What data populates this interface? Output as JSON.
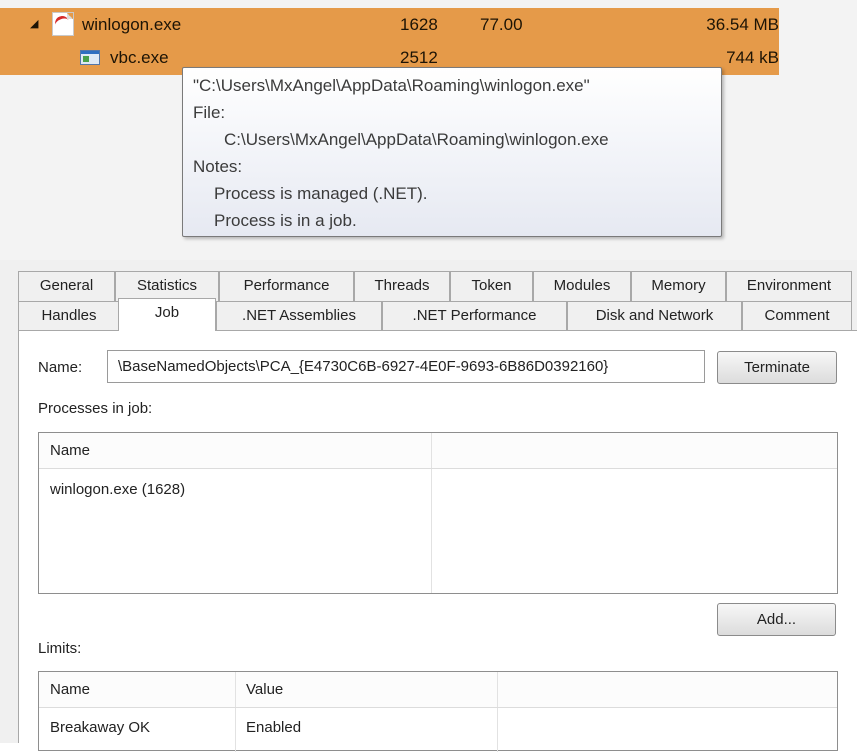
{
  "processes": [
    {
      "name": "winlogon.exe",
      "pid": "1628",
      "cpu": "77.00",
      "memory": "36.54 MB"
    },
    {
      "name": "vbc.exe",
      "pid": "2512",
      "cpu": "",
      "memory": "744 kB"
    }
  ],
  "tooltip": {
    "command": "\"C:\\Users\\MxAngel\\AppData\\Roaming\\winlogon.exe\"",
    "file_label": "File:",
    "file_path": "C:\\Users\\MxAngel\\AppData\\Roaming\\winlogon.exe",
    "notes_label": "Notes:",
    "note1": "Process is managed (.NET).",
    "note2": "Process is in a job."
  },
  "tabs_row1": [
    "General",
    "Statistics",
    "Performance",
    "Threads",
    "Token",
    "Modules",
    "Memory",
    "Environment"
  ],
  "tabs_row2": [
    "Handles",
    "Job",
    ".NET Assemblies",
    ".NET Performance",
    "Disk and Network",
    "Comment"
  ],
  "active_tab": "Job",
  "job": {
    "name_label": "Name:",
    "name_value": "\\BaseNamedObjects\\PCA_{E4730C6B-6927-4E0F-9693-6B86D0392160}",
    "terminate_label": "Terminate",
    "processes_label": "Processes in job:",
    "processes_header": [
      "Name"
    ],
    "processes_rows": [
      "winlogon.exe (1628)"
    ],
    "add_label": "Add...",
    "limits_label": "Limits:",
    "limits_header": [
      "Name",
      "Value"
    ],
    "limits_rows": [
      {
        "name": "Breakaway OK",
        "value": "Enabled"
      }
    ]
  }
}
